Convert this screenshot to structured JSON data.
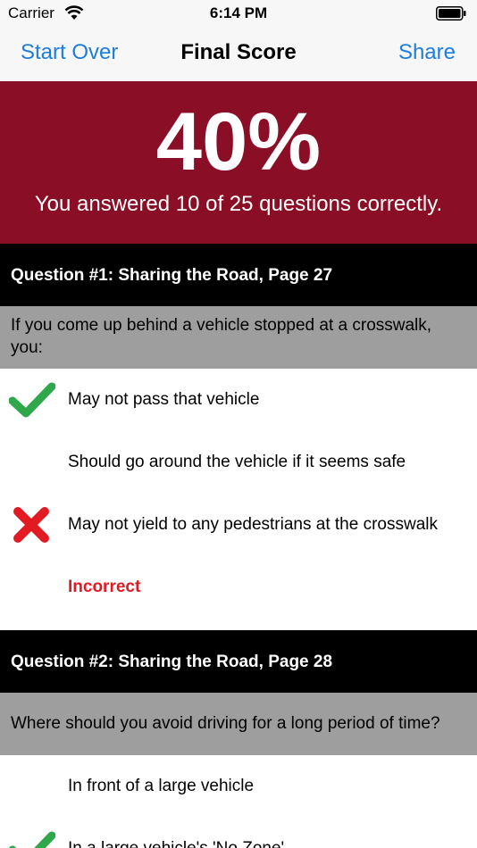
{
  "status_bar": {
    "carrier": "Carrier",
    "time": "6:14 PM"
  },
  "nav": {
    "left_button": "Start Over",
    "title": "Final Score",
    "right_button": "Share"
  },
  "score": {
    "percent": "40%",
    "summary": "You answered 10 of 25 questions correctly."
  },
  "questions": [
    {
      "header": "Question #1: Sharing the Road, Page 27",
      "prompt": "If you come up behind a vehicle stopped at a crosswalk, you:",
      "answers": [
        {
          "text": "May not pass that vehicle",
          "mark": "check-icon"
        },
        {
          "text": "Should go around the vehicle if it seems safe",
          "mark": ""
        },
        {
          "text": "May not yield to any pedestrians at the crosswalk",
          "mark": "cross-icon"
        }
      ],
      "result": "Incorrect"
    },
    {
      "header": "Question #2: Sharing the Road, Page 28",
      "prompt": "Where should you avoid driving for a long period of time?",
      "answers": [
        {
          "text": "In front of a large vehicle",
          "mark": ""
        },
        {
          "text": "In a large vehicle's 'No Zone'",
          "mark": "check-icon"
        }
      ]
    }
  ],
  "colors": {
    "banner": "#8b0e27",
    "link": "#1e7ddc",
    "correct": "#2ea84a",
    "incorrect": "#e21b23"
  }
}
